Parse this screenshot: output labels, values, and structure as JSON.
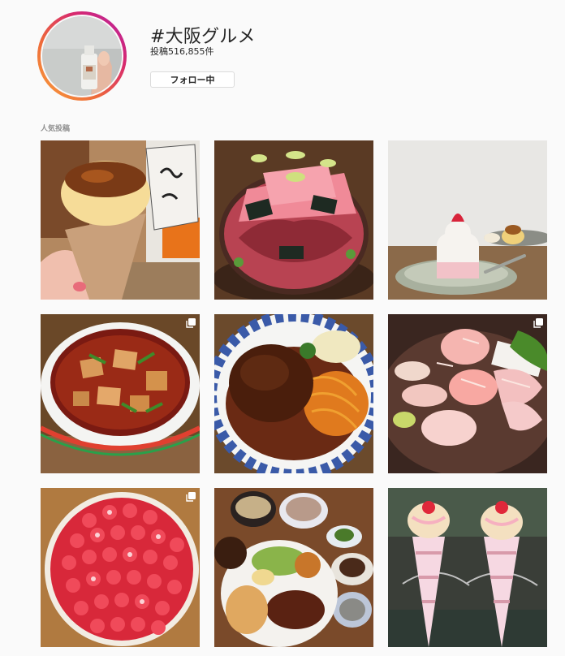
{
  "hashtag": {
    "title": "#大阪グルメ",
    "post_count": "投稿516,855件",
    "follow_label": "フォロー中"
  },
  "section": {
    "top_posts_label": "人気投稿"
  },
  "posts": [
    {
      "name": "post-cheese-crepe",
      "multi": false
    },
    {
      "name": "post-tuna-bowl",
      "multi": false
    },
    {
      "name": "post-strawberry-cake",
      "multi": false
    },
    {
      "name": "post-mapo-tofu",
      "multi": true
    },
    {
      "name": "post-hamburg-steak",
      "multi": false
    },
    {
      "name": "post-sashimi-platter",
      "multi": true
    },
    {
      "name": "post-strawberry-tart",
      "multi": true
    },
    {
      "name": "post-teishoku-set",
      "multi": false
    },
    {
      "name": "post-crepe-cones",
      "multi": false
    }
  ],
  "icons": {
    "multi_photo": "multiple-photos-icon"
  }
}
